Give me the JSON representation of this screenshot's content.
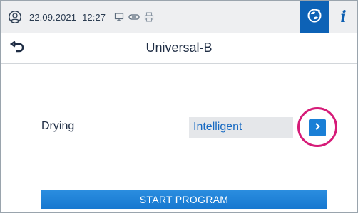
{
  "status_bar": {
    "date": "22.09.2021",
    "time": "12:27",
    "icons": [
      "user-circle-icon",
      "display-icon",
      "link-icon",
      "printer-icon"
    ],
    "tools": [
      "refresh-globe-icon",
      "info-icon"
    ],
    "info_label": "i"
  },
  "header": {
    "title": "Universal-B",
    "back_icon": "back-arrow-icon"
  },
  "setting": {
    "label": "Drying",
    "value": "Intelligent",
    "next_icon": "chevron-right-icon"
  },
  "actions": {
    "start_label": "START PROGRAM"
  },
  "colors": {
    "accent": "#1a7fd6",
    "primary_dark": "#0d62b6",
    "highlight": "#d61b78",
    "value_text": "#1669c2"
  }
}
